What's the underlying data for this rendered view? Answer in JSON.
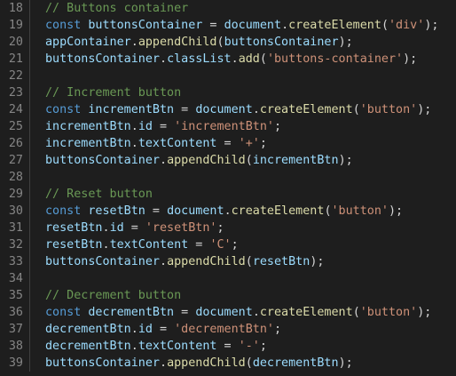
{
  "editor": {
    "lines": [
      {
        "number": "18",
        "tokens": [
          {
            "t": "// Buttons container",
            "c": "comment"
          }
        ]
      },
      {
        "number": "19",
        "tokens": [
          {
            "t": "const",
            "c": "keyword"
          },
          {
            "t": " ",
            "c": "plain"
          },
          {
            "t": "buttonsContainer",
            "c": "variable"
          },
          {
            "t": " = ",
            "c": "plain"
          },
          {
            "t": "document",
            "c": "variable"
          },
          {
            "t": ".",
            "c": "plain"
          },
          {
            "t": "createElement",
            "c": "function"
          },
          {
            "t": "(",
            "c": "plain"
          },
          {
            "t": "'div'",
            "c": "string"
          },
          {
            "t": ");",
            "c": "plain"
          }
        ]
      },
      {
        "number": "20",
        "tokens": [
          {
            "t": "appContainer",
            "c": "variable"
          },
          {
            "t": ".",
            "c": "plain"
          },
          {
            "t": "appendChild",
            "c": "function"
          },
          {
            "t": "(",
            "c": "plain"
          },
          {
            "t": "buttonsContainer",
            "c": "variable"
          },
          {
            "t": ");",
            "c": "plain"
          }
        ]
      },
      {
        "number": "21",
        "tokens": [
          {
            "t": "buttonsContainer",
            "c": "variable"
          },
          {
            "t": ".",
            "c": "plain"
          },
          {
            "t": "classList",
            "c": "variable"
          },
          {
            "t": ".",
            "c": "plain"
          },
          {
            "t": "add",
            "c": "function"
          },
          {
            "t": "(",
            "c": "plain"
          },
          {
            "t": "'buttons-container'",
            "c": "string"
          },
          {
            "t": ");",
            "c": "plain"
          }
        ]
      },
      {
        "number": "22",
        "tokens": []
      },
      {
        "number": "23",
        "tokens": [
          {
            "t": "// Increment button",
            "c": "comment"
          }
        ]
      },
      {
        "number": "24",
        "tokens": [
          {
            "t": "const",
            "c": "keyword"
          },
          {
            "t": " ",
            "c": "plain"
          },
          {
            "t": "incrementBtn",
            "c": "variable"
          },
          {
            "t": " = ",
            "c": "plain"
          },
          {
            "t": "document",
            "c": "variable"
          },
          {
            "t": ".",
            "c": "plain"
          },
          {
            "t": "createElement",
            "c": "function"
          },
          {
            "t": "(",
            "c": "plain"
          },
          {
            "t": "'button'",
            "c": "string"
          },
          {
            "t": ");",
            "c": "plain"
          }
        ]
      },
      {
        "number": "25",
        "tokens": [
          {
            "t": "incrementBtn",
            "c": "variable"
          },
          {
            "t": ".",
            "c": "plain"
          },
          {
            "t": "id",
            "c": "variable"
          },
          {
            "t": " = ",
            "c": "plain"
          },
          {
            "t": "'incrementBtn'",
            "c": "string"
          },
          {
            "t": ";",
            "c": "plain"
          }
        ]
      },
      {
        "number": "26",
        "tokens": [
          {
            "t": "incrementBtn",
            "c": "variable"
          },
          {
            "t": ".",
            "c": "plain"
          },
          {
            "t": "textContent",
            "c": "variable"
          },
          {
            "t": " = ",
            "c": "plain"
          },
          {
            "t": "'+'",
            "c": "string"
          },
          {
            "t": ";",
            "c": "plain"
          }
        ]
      },
      {
        "number": "27",
        "tokens": [
          {
            "t": "buttonsContainer",
            "c": "variable"
          },
          {
            "t": ".",
            "c": "plain"
          },
          {
            "t": "appendChild",
            "c": "function"
          },
          {
            "t": "(",
            "c": "plain"
          },
          {
            "t": "incrementBtn",
            "c": "variable"
          },
          {
            "t": ");",
            "c": "plain"
          }
        ]
      },
      {
        "number": "28",
        "tokens": []
      },
      {
        "number": "29",
        "tokens": [
          {
            "t": "// Reset button",
            "c": "comment"
          }
        ]
      },
      {
        "number": "30",
        "tokens": [
          {
            "t": "const",
            "c": "keyword"
          },
          {
            "t": " ",
            "c": "plain"
          },
          {
            "t": "resetBtn",
            "c": "variable"
          },
          {
            "t": " = ",
            "c": "plain"
          },
          {
            "t": "document",
            "c": "variable"
          },
          {
            "t": ".",
            "c": "plain"
          },
          {
            "t": "createElement",
            "c": "function"
          },
          {
            "t": "(",
            "c": "plain"
          },
          {
            "t": "'button'",
            "c": "string"
          },
          {
            "t": ");",
            "c": "plain"
          }
        ]
      },
      {
        "number": "31",
        "tokens": [
          {
            "t": "resetBtn",
            "c": "variable"
          },
          {
            "t": ".",
            "c": "plain"
          },
          {
            "t": "id",
            "c": "variable"
          },
          {
            "t": " = ",
            "c": "plain"
          },
          {
            "t": "'resetBtn'",
            "c": "string"
          },
          {
            "t": ";",
            "c": "plain"
          }
        ]
      },
      {
        "number": "32",
        "tokens": [
          {
            "t": "resetBtn",
            "c": "variable"
          },
          {
            "t": ".",
            "c": "plain"
          },
          {
            "t": "textContent",
            "c": "variable"
          },
          {
            "t": " = ",
            "c": "plain"
          },
          {
            "t": "'C'",
            "c": "string"
          },
          {
            "t": ";",
            "c": "plain"
          }
        ]
      },
      {
        "number": "33",
        "tokens": [
          {
            "t": "buttonsContainer",
            "c": "variable"
          },
          {
            "t": ".",
            "c": "plain"
          },
          {
            "t": "appendChild",
            "c": "function"
          },
          {
            "t": "(",
            "c": "plain"
          },
          {
            "t": "resetBtn",
            "c": "variable"
          },
          {
            "t": ");",
            "c": "plain"
          }
        ]
      },
      {
        "number": "34",
        "tokens": []
      },
      {
        "number": "35",
        "tokens": [
          {
            "t": "// Decrement button",
            "c": "comment"
          }
        ]
      },
      {
        "number": "36",
        "tokens": [
          {
            "t": "const",
            "c": "keyword"
          },
          {
            "t": " ",
            "c": "plain"
          },
          {
            "t": "decrementBtn",
            "c": "variable"
          },
          {
            "t": " = ",
            "c": "plain"
          },
          {
            "t": "document",
            "c": "variable"
          },
          {
            "t": ".",
            "c": "plain"
          },
          {
            "t": "createElement",
            "c": "function"
          },
          {
            "t": "(",
            "c": "plain"
          },
          {
            "t": "'button'",
            "c": "string"
          },
          {
            "t": ");",
            "c": "plain"
          }
        ]
      },
      {
        "number": "37",
        "tokens": [
          {
            "t": "decrementBtn",
            "c": "variable"
          },
          {
            "t": ".",
            "c": "plain"
          },
          {
            "t": "id",
            "c": "variable"
          },
          {
            "t": " = ",
            "c": "plain"
          },
          {
            "t": "'decrementBtn'",
            "c": "string"
          },
          {
            "t": ";",
            "c": "plain"
          }
        ]
      },
      {
        "number": "38",
        "tokens": [
          {
            "t": "decrementBtn",
            "c": "variable"
          },
          {
            "t": ".",
            "c": "plain"
          },
          {
            "t": "textContent",
            "c": "variable"
          },
          {
            "t": " = ",
            "c": "plain"
          },
          {
            "t": "'-'",
            "c": "string"
          },
          {
            "t": ";",
            "c": "plain"
          }
        ]
      },
      {
        "number": "39",
        "tokens": [
          {
            "t": "buttonsContainer",
            "c": "variable"
          },
          {
            "t": ".",
            "c": "plain"
          },
          {
            "t": "appendChild",
            "c": "function"
          },
          {
            "t": "(",
            "c": "plain"
          },
          {
            "t": "decrementBtn",
            "c": "variable"
          },
          {
            "t": ");",
            "c": "plain"
          }
        ]
      }
    ]
  },
  "theme": {
    "background": "#1e1e1e",
    "comment": "#6a9955",
    "keyword": "#569cd6",
    "variable": "#9cdcfe",
    "function": "#dcdcaa",
    "string": "#ce9178",
    "plain": "#d4d4d4",
    "line_number": "#858585"
  }
}
